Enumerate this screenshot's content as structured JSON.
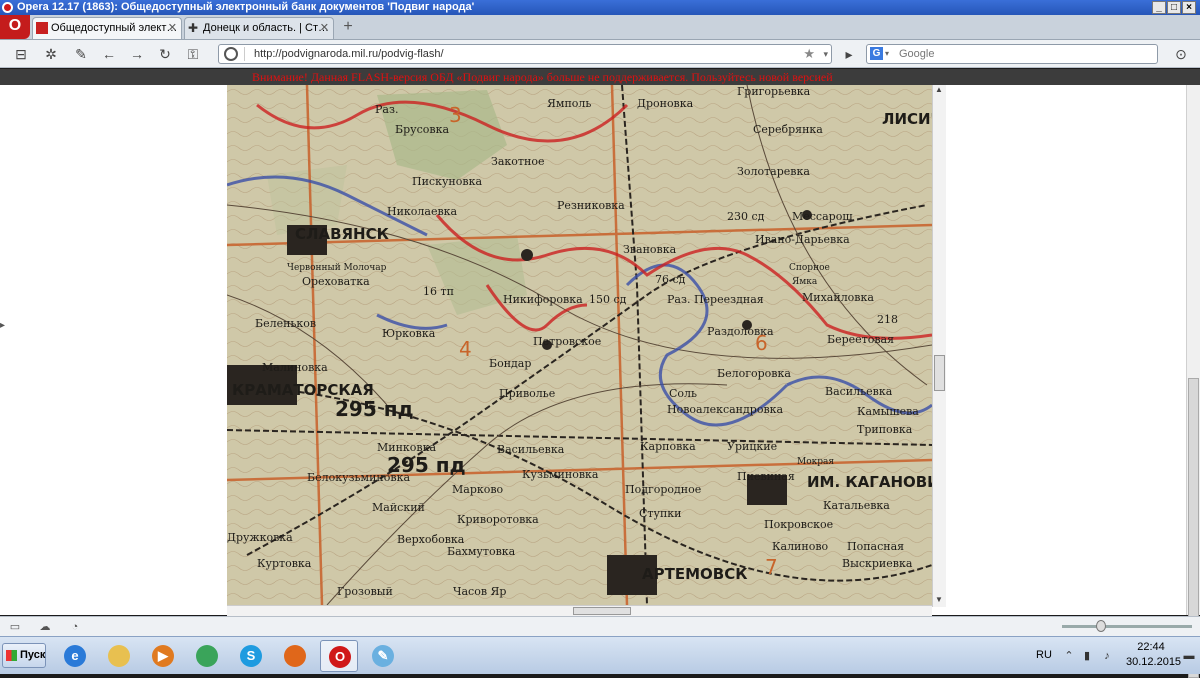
{
  "window": {
    "title": "Opera 12.17 (1863): Общедоступный электронный банк документов 'Подвиг народа'",
    "minimize_icon": "minimize-icon",
    "maximize_icon": "maximize-icon",
    "close_icon": "close-icon"
  },
  "tabs": [
    {
      "label": "Общедоступный элект…",
      "active": true
    },
    {
      "label": "Донецк и область. | Ст…",
      "active": false
    }
  ],
  "opera_menu_label": "O",
  "toolbar": {
    "url": "http://podvignaroda.mil.ru/podvig-flash/",
    "search_engine": "G",
    "search_placeholder": "Google"
  },
  "warning": {
    "text": "Внимание! Данная FLASH-версия ОБД «Подвиг народа» больше не поддерживается. Пользуйтесь новой версией"
  },
  "map": {
    "labels": [
      {
        "text": "СЛАВЯНСК",
        "cls": "big"
      },
      {
        "text": "КРАМАТОРСКАЯ",
        "cls": "big"
      },
      {
        "text": "АРТЕМОВСК",
        "cls": "big"
      },
      {
        "text": "ИМ. КАГАНОВИЧА",
        "cls": "big"
      },
      {
        "text": "ЛИСИЧ",
        "cls": "big"
      },
      {
        "text": "295 пд",
        "cls": "xl"
      },
      {
        "text": "295 пд",
        "cls": "xl"
      },
      {
        "text": "230 сд",
        "cls": "med"
      },
      {
        "text": "Мессарош",
        "cls": "med"
      },
      {
        "text": "Серебрянка",
        "cls": "med"
      },
      {
        "text": "Золотаревка",
        "cls": "med"
      },
      {
        "text": "Григорьевка",
        "cls": "med"
      },
      {
        "text": "Ямполь",
        "cls": "med"
      },
      {
        "text": "Дроновка",
        "cls": "med"
      },
      {
        "text": "Брусовка",
        "cls": "med"
      },
      {
        "text": "Пискуновка",
        "cls": "med"
      },
      {
        "text": "Закотное",
        "cls": "med"
      },
      {
        "text": "Николаевка",
        "cls": "med"
      },
      {
        "text": "Резниковка",
        "cls": "med"
      },
      {
        "text": "Ивано-Дарьевка",
        "cls": "med"
      },
      {
        "text": "Михайловка",
        "cls": "med"
      },
      {
        "text": "Звановка",
        "cls": "med"
      },
      {
        "text": "Раз. Переездная",
        "cls": "med"
      },
      {
        "text": "Раздоловка",
        "cls": "med"
      },
      {
        "text": "Береетовая",
        "cls": "med"
      },
      {
        "text": "Белогоровка",
        "cls": "med"
      },
      {
        "text": "Васильевка",
        "cls": "med"
      },
      {
        "text": "Камышева",
        "cls": "med"
      },
      {
        "text": "Триповка",
        "cls": "med"
      },
      {
        "text": "Новоалександровка",
        "cls": "med"
      },
      {
        "text": "Соль",
        "cls": "med"
      },
      {
        "text": "Карповка",
        "cls": "med"
      },
      {
        "text": "Урицкие",
        "cls": "med"
      },
      {
        "text": "Пиевиная",
        "cls": "med"
      },
      {
        "text": "Катальевка",
        "cls": "med"
      },
      {
        "text": "Покровское",
        "cls": "med"
      },
      {
        "text": "Калиново",
        "cls": "med"
      },
      {
        "text": "Попасная",
        "cls": "med"
      },
      {
        "text": "Выскриевка",
        "cls": "med"
      },
      {
        "text": "Петровское",
        "cls": "med"
      },
      {
        "text": "Бондар",
        "cls": "med"
      },
      {
        "text": "Приволье",
        "cls": "med"
      },
      {
        "text": "Васильевка",
        "cls": "med"
      },
      {
        "text": "Кузьминовка",
        "cls": "med"
      },
      {
        "text": "Подгородное",
        "cls": "med"
      },
      {
        "text": "Ступки",
        "cls": "med"
      },
      {
        "text": "Малиновка",
        "cls": "med"
      },
      {
        "text": "Беленьков",
        "cls": "med"
      },
      {
        "text": "Ореховатка",
        "cls": "med"
      },
      {
        "text": "Юрковка",
        "cls": "med"
      },
      {
        "text": "Минковка",
        "cls": "med"
      },
      {
        "text": "Белокузьминовка",
        "cls": "med"
      },
      {
        "text": "Марково",
        "cls": "med"
      },
      {
        "text": "Майский",
        "cls": "med"
      },
      {
        "text": "Криворотовка",
        "cls": "med"
      },
      {
        "text": "Дружковка",
        "cls": "med"
      },
      {
        "text": "Верхобовка",
        "cls": "med"
      },
      {
        "text": "Куртовка",
        "cls": "med"
      },
      {
        "text": "Бахмутовка",
        "cls": "med"
      },
      {
        "text": "Грозовый",
        "cls": "med"
      },
      {
        "text": "Часов Яр",
        "cls": "med"
      },
      {
        "text": "Червонный Молочар",
        "cls": "sm"
      },
      {
        "text": "Никифоровка",
        "cls": "med"
      },
      {
        "text": "16 тп",
        "cls": "med"
      },
      {
        "text": "Спорное",
        "cls": "sm"
      },
      {
        "text": "Ямка",
        "cls": "sm"
      },
      {
        "text": "Раз.",
        "cls": "med"
      },
      {
        "text": "Мокрая",
        "cls": "sm"
      },
      {
        "text": "3",
        "cls": "orange"
      },
      {
        "text": "4",
        "cls": "orange"
      },
      {
        "text": "6",
        "cls": "orange"
      },
      {
        "text": "7",
        "cls": "orange"
      },
      {
        "text": "218",
        "cls": "med"
      },
      {
        "text": "76 сд",
        "cls": "med"
      },
      {
        "text": "150 сд",
        "cls": "med"
      }
    ]
  },
  "statusbar": {
    "icons": [
      "panel-icon",
      "cloud-icon",
      "speed-dial-icon"
    ]
  },
  "taskbar": {
    "start_label": "Пуск",
    "apps": [
      {
        "name": "ie-icon",
        "glyph": "e",
        "color": "#2a7ad8"
      },
      {
        "name": "folder-icon",
        "glyph": "",
        "color": "#e8c050"
      },
      {
        "name": "media-player-icon",
        "glyph": "▶",
        "color": "#e07a20"
      },
      {
        "name": "chrome-icon",
        "glyph": "",
        "color": "#3aa45a"
      },
      {
        "name": "skype-icon",
        "glyph": "S",
        "color": "#1e9be0"
      },
      {
        "name": "firefox-icon",
        "glyph": "",
        "color": "#e0671a"
      },
      {
        "name": "opera-icon",
        "glyph": "O",
        "color": "#d01818"
      },
      {
        "name": "paint-icon",
        "glyph": "✎",
        "color": "#6ab0e0"
      }
    ],
    "lang": "RU",
    "time": "22:44",
    "date": "30.12.2015"
  }
}
